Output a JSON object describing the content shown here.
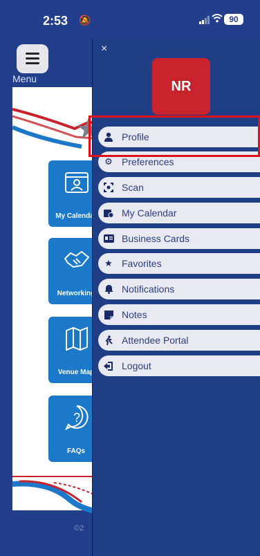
{
  "status_bar": {
    "time": "2:53",
    "battery": "90"
  },
  "background": {
    "menu_label": "Menu",
    "tiles": [
      {
        "label": "My Calendar",
        "icon": "calendar-user-icon"
      },
      {
        "label": "Networking",
        "icon": "handshake-icon"
      },
      {
        "label": "Venue Map",
        "icon": "map-icon"
      },
      {
        "label": "FAQs",
        "icon": "question-icon"
      }
    ],
    "footer": "©2"
  },
  "drawer": {
    "close": "×",
    "avatar_initials": "NR",
    "items": [
      {
        "label": "Profile",
        "icon": "user-icon"
      },
      {
        "label": "Preferences",
        "icon": "gear-icon"
      },
      {
        "label": "Scan",
        "icon": "scan-icon"
      },
      {
        "label": "My Calendar",
        "icon": "calendar-clock-icon"
      },
      {
        "label": "Business Cards",
        "icon": "id-card-icon"
      },
      {
        "label": "Favorites",
        "icon": "star-icon"
      },
      {
        "label": "Notifications",
        "icon": "bell-icon"
      },
      {
        "label": "Notes",
        "icon": "notes-icon"
      },
      {
        "label": "Attendee Portal",
        "icon": "person-walking-icon"
      },
      {
        "label": "Logout",
        "icon": "logout-icon"
      }
    ]
  },
  "colors": {
    "brand_blue": "#1f3e86",
    "tile_blue": "#1c78c9",
    "avatar_red": "#c8232c",
    "highlight_red": "#e0101a"
  }
}
